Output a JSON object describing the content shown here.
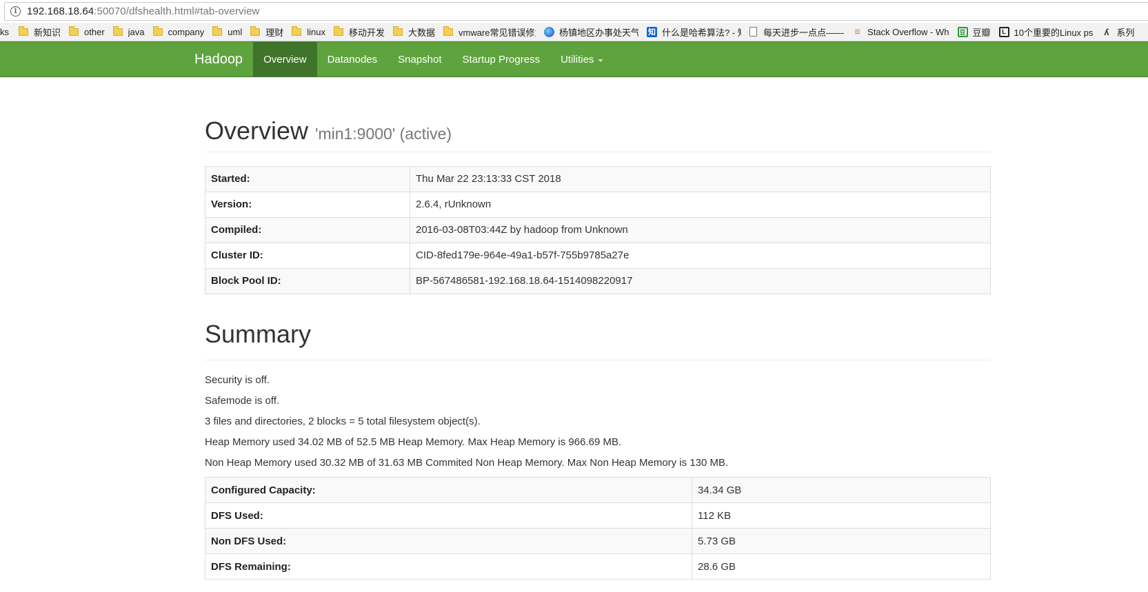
{
  "address_bar": {
    "url_host": "192.168.18.64",
    "url_rest": ":50070/dfshealth.html#tab-overview"
  },
  "bookmarks": [
    {
      "label": "ks",
      "icon": "none"
    },
    {
      "label": "新知识",
      "icon": "folder-icon"
    },
    {
      "label": "other",
      "icon": "folder-icon"
    },
    {
      "label": "java",
      "icon": "folder-icon"
    },
    {
      "label": "company",
      "icon": "folder-icon"
    },
    {
      "label": "uml",
      "icon": "folder-icon"
    },
    {
      "label": "理财",
      "icon": "folder-icon"
    },
    {
      "label": "linux",
      "icon": "folder-icon"
    },
    {
      "label": "移动开发",
      "icon": "folder-icon"
    },
    {
      "label": "大数据",
      "icon": "folder-icon"
    },
    {
      "label": "vmware常见错误修复",
      "icon": "folder-icon"
    },
    {
      "label": "杨镇地区办事处天气",
      "icon": "globe-icon"
    },
    {
      "label": "什么是哈希算法? - 知",
      "icon": "zhihu-icon"
    },
    {
      "label": "每天进步一点点——",
      "icon": "page-icon"
    },
    {
      "label": "Stack Overflow - Wh",
      "icon": "stackoverflow-icon"
    },
    {
      "label": "豆瓣",
      "icon": "douban-icon"
    },
    {
      "label": "10个重要的Linux ps",
      "icon": "bookmark-icon"
    },
    {
      "label": "系列",
      "icon": "series-icon"
    }
  ],
  "navbar": {
    "brand": "Hadoop",
    "items": [
      {
        "label": "Overview",
        "active": true
      },
      {
        "label": "Datanodes",
        "active": false
      },
      {
        "label": "Snapshot",
        "active": false
      },
      {
        "label": "Startup Progress",
        "active": false
      },
      {
        "label": "Utilities",
        "active": false,
        "dropdown": true
      }
    ],
    "color": "#5fa33e",
    "active_color": "#3f742a"
  },
  "overview": {
    "title": "Overview",
    "subtitle": "'min1:9000' (active)",
    "rows": [
      {
        "key": "Started:",
        "value": "Thu Mar 22 23:13:33 CST 2018"
      },
      {
        "key": "Version:",
        "value": "2.6.4, rUnknown"
      },
      {
        "key": "Compiled:",
        "value": "2016-03-08T03:44Z by hadoop from Unknown"
      },
      {
        "key": "Cluster ID:",
        "value": "CID-8fed179e-964e-49a1-b57f-755b9785a27e"
      },
      {
        "key": "Block Pool ID:",
        "value": "BP-567486581-192.168.18.64-1514098220917"
      }
    ]
  },
  "summary": {
    "title": "Summary",
    "lines": [
      "Security is off.",
      "Safemode is off.",
      "3 files and directories, 2 blocks = 5 total filesystem object(s).",
      "Heap Memory used 34.02 MB of 52.5 MB Heap Memory. Max Heap Memory is 966.69 MB.",
      "Non Heap Memory used 30.32 MB of 31.63 MB Commited Non Heap Memory. Max Non Heap Memory is 130 MB."
    ],
    "rows": [
      {
        "key": "Configured Capacity:",
        "value": "34.34 GB"
      },
      {
        "key": "DFS Used:",
        "value": "112 KB"
      },
      {
        "key": "Non DFS Used:",
        "value": "5.73 GB"
      },
      {
        "key": "DFS Remaining:",
        "value": "28.6 GB"
      }
    ]
  }
}
